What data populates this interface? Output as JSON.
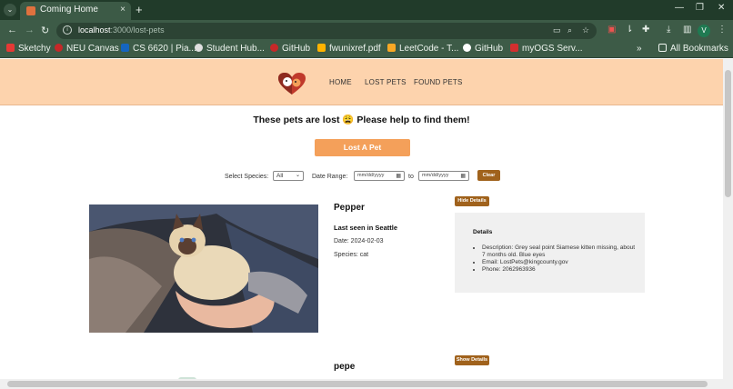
{
  "browser": {
    "tab_title": "Coming Home",
    "tab_close": "×",
    "new_tab": "+",
    "url_host": "localhost",
    "url_path": ":3000/lost-pets",
    "win_min": "—",
    "win_restore": "❐",
    "win_close": "✕",
    "bookmarks": [
      {
        "label": "Sketchy",
        "color": "#e53935"
      },
      {
        "label": "NEU Canvas",
        "color": "#c62828"
      },
      {
        "label": "CS 6620 | Pia...",
        "color": "#1565c0"
      },
      {
        "label": "Student Hub...",
        "color": "#e0e0e0"
      },
      {
        "label": "GitHub",
        "color": "#c62828"
      },
      {
        "label": "fwunixref.pdf",
        "color": "#ffb300"
      },
      {
        "label": "LeetCode - T...",
        "color": "#f9a825"
      },
      {
        "label": "GitHub",
        "color": "#ffffff"
      },
      {
        "label": "myOGS Serv...",
        "color": "#d32f2f"
      }
    ],
    "overflow": "»",
    "all_bookmarks": "All Bookmarks",
    "profile_initial": "V"
  },
  "site": {
    "nav": [
      "HOME",
      "LOST PETS",
      "FOUND PETS"
    ],
    "headline": "These pets are lost 😩 Please help to find them!",
    "lost_button": "Lost A Pet",
    "filters": {
      "species_label": "Select Species:",
      "species_value": "All",
      "date_label": "Date Range:",
      "date_placeholder": "mm/dd/yyyy",
      "to_label": "to",
      "clear_label": "Clear"
    },
    "pets": [
      {
        "name": "Pepper",
        "last_seen": "Last seen in Seattle",
        "date": "Date: 2024-02-03",
        "species": "Species: cat",
        "details_toggle": "Hide Details",
        "details_title": "Details",
        "details": [
          "Description: Grey seal point Siamese kitten missing, about 7 months old. Blue eyes",
          "Email: LostPets@kingcounty.gov",
          "Phone: 2062963936"
        ]
      },
      {
        "name": "pepe",
        "details_toggle": "Show Details"
      }
    ]
  }
}
